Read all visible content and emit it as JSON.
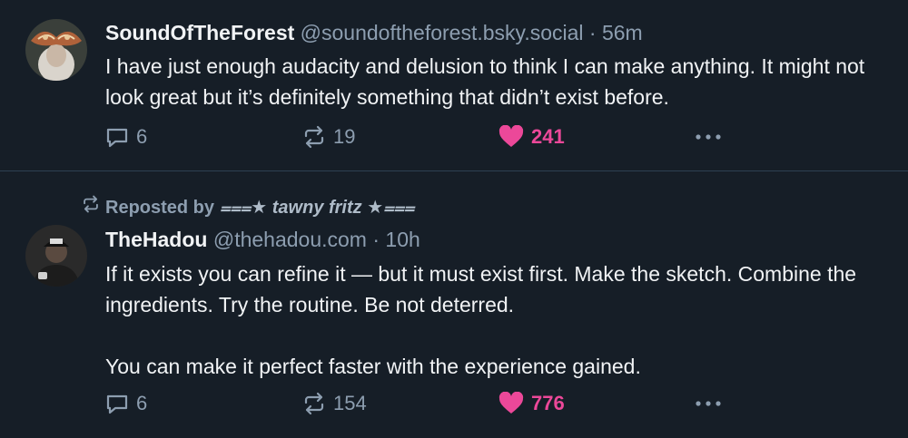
{
  "posts": [
    {
      "author": "SoundOfTheForest",
      "handle": "@soundoftheforest.bsky.social",
      "time": "· 56m",
      "text": "I have just enough audacity and delusion to think I can make anything. It might not look great but it’s definitely something that didn’t exist before.",
      "replies": "6",
      "reposts": "19",
      "likes": "241",
      "liked": true
    },
    {
      "repost_label": "Reposted by",
      "repost_by": "⩶★ tawny fritz ★⩶",
      "author": "TheHadou",
      "handle": "@thehadou.com",
      "time": "· 10h",
      "text_lines": [
        "If it exists you can refine it — but it must exist first. Make the sketch. Combine the ingredients. Try the routine. Be not deterred.",
        "You can make it perfect faster with the experience gained."
      ],
      "replies": "6",
      "reposts": "154",
      "likes": "776",
      "liked": true
    }
  ],
  "colors": {
    "background": "#161e27",
    "text": "#f1f3f5",
    "muted": "#8d9eb0",
    "like": "#ec4899",
    "divider": "#2e4052"
  },
  "icons": [
    "reply-icon",
    "repost-icon",
    "heart-icon",
    "more-icon"
  ]
}
